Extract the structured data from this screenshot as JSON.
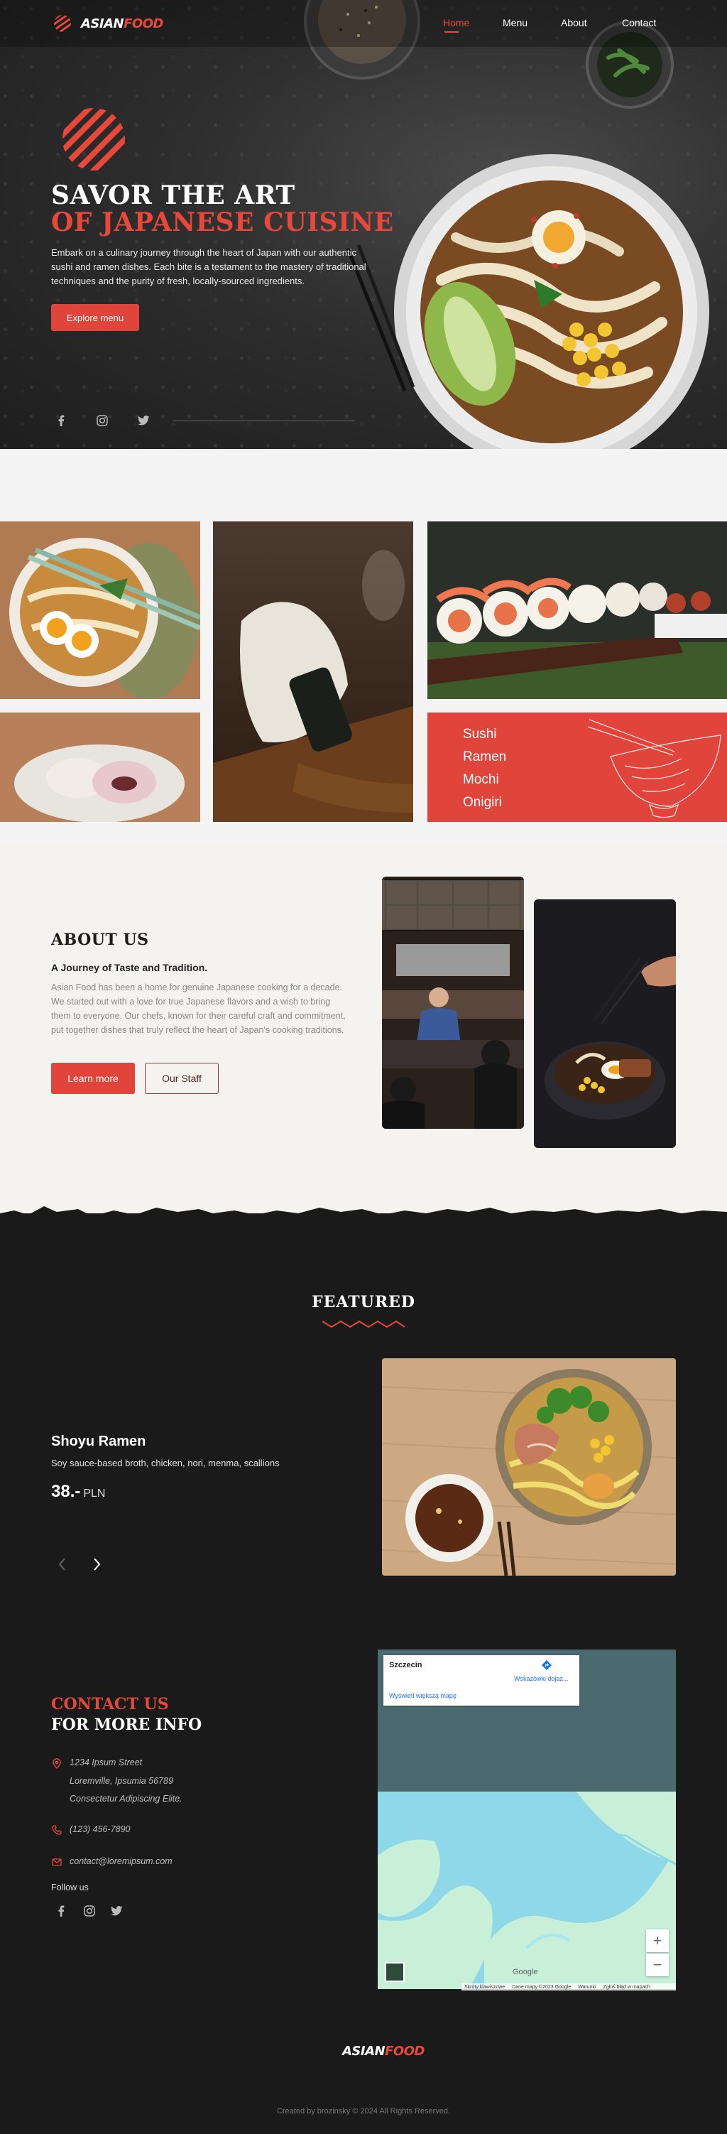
{
  "brand": {
    "logo_word1": "ASIAN",
    "logo_word2": "FOOD",
    "accent": "#e8473a",
    "dark": "#1a1a1a"
  },
  "nav": {
    "items": [
      {
        "label": "Home",
        "active": true
      },
      {
        "label": "Menu"
      },
      {
        "label": "About"
      },
      {
        "label": "Contact"
      }
    ]
  },
  "hero": {
    "title_line1": "SAVOR THE ART",
    "title_line2": "OF JAPANESE CUISINE",
    "description": "Embark on a culinary journey through the heart of Japan with our authentic sushi and ramen dishes. Each bite is a testament to the mastery of traditional techniques and the purity of fresh, locally-sourced ingredients.",
    "cta": "Explore menu",
    "social_icons": [
      "facebook-icon",
      "instagram-icon",
      "twitter-icon"
    ]
  },
  "gallery": {
    "menu_items": [
      "Sushi",
      "Ramen",
      "Mochi",
      "Onigiri"
    ]
  },
  "about": {
    "title": "ABOUT US",
    "subtitle": "A Journey of Taste and Tradition.",
    "body": "Asian Food has been a home for genuine Japanese cooking for a decade. We started out with a love for true Japanese flavors and a wish to bring them to everyone. Our chefs, known for their careful craft and commitment, put together dishes that truly reflect the heart of Japan's cooking traditions.",
    "learn_more": "Learn more",
    "our_staff": "Our Staff"
  },
  "featured": {
    "title": "FEATURED",
    "dish_name": "Shoyu Ramen",
    "dish_desc": "Soy sauce-based broth, chicken, nori, menma, scallions",
    "price": "38.-",
    "currency": "PLN",
    "prev_icon": "chevron-left-icon",
    "next_icon": "chevron-right-icon"
  },
  "contact": {
    "title1": "CONTACT US",
    "title2": "FOR MORE INFO",
    "address_line1": "1234 Ipsum Street",
    "address_line2": "Loremville, Ipsumia 56789",
    "address_line3": "Consectetur Adipiscing Elite.",
    "phone": "(123) 456-7890",
    "email": "contact@loremipsum.com",
    "follow": "Follow us"
  },
  "map": {
    "city": "Szczecin",
    "directions": "Wskazówki dojaz...",
    "larger_map": "Wyświetl większą mapę",
    "footer_items": [
      "Skróty klawiszowe",
      "Dane mapy ©2023 Google",
      "Warunki",
      "Zgłoś błąd w mapach"
    ],
    "google": "Google",
    "water_colors": {
      "water": "#8fd8ea",
      "land": "#c8efd8"
    }
  },
  "footer": {
    "copyright": "Created by brozinsky © 2024 All Rights Reserved."
  }
}
